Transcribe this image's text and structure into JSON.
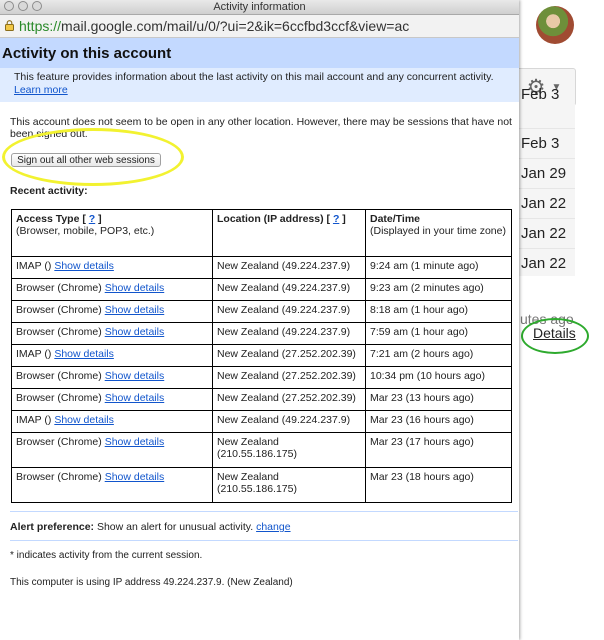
{
  "window": {
    "title": "Activity information",
    "url_scheme": "https://",
    "url_rest": "mail.google.com/mail/u/0/?ui=2&ik=6ccfbd3ccf&view=ac"
  },
  "header": {
    "title": "Activity on this account",
    "info_text": "This feature provides information about the last activity on this mail account and any concurrent activity.",
    "learn_more": "Learn more"
  },
  "notice": {
    "text": "This account does not seem to be open in any other location. However, there may be sessions that have not been signed out.",
    "signout_label": "Sign out all other web sessions"
  },
  "recent": {
    "heading": "Recent activity:",
    "table": {
      "col1_title": "Access Type",
      "col1_help": "?",
      "col1_sub": "(Browser, mobile, POP3, etc.)",
      "col2_title": "Location (IP address)",
      "col2_help": "?",
      "col3_title": "Date/Time",
      "col3_sub": "(Displayed in your time zone)",
      "show_details_label": "Show details",
      "rows": [
        {
          "type": "IMAP ()",
          "location": "New Zealand (49.224.237.9)",
          "time": "9:24 am (1 minute ago)"
        },
        {
          "type": "Browser (Chrome)",
          "location": "New Zealand (49.224.237.9)",
          "time": "9:23 am (2 minutes ago)"
        },
        {
          "type": "Browser (Chrome)",
          "location": "New Zealand (49.224.237.9)",
          "time": "8:18 am (1 hour ago)"
        },
        {
          "type": "Browser (Chrome)",
          "location": "New Zealand (49.224.237.9)",
          "time": "7:59 am (1 hour ago)"
        },
        {
          "type": "IMAP ()",
          "location": "New Zealand (27.252.202.39)",
          "time": "7:21 am (2 hours ago)"
        },
        {
          "type": "Browser (Chrome)",
          "location": "New Zealand (27.252.202.39)",
          "time": "10:34 pm (10 hours ago)"
        },
        {
          "type": "Browser (Chrome)",
          "location": "New Zealand (27.252.202.39)",
          "time": "Mar 23 (13 hours ago)"
        },
        {
          "type": "IMAP ()",
          "location": "New Zealand (49.224.237.9)",
          "time": "Mar 23 (16 hours ago)"
        },
        {
          "type": "Browser (Chrome)",
          "location": "New Zealand (210.55.186.175)",
          "time": "Mar 23 (17 hours ago)"
        },
        {
          "type": "Browser (Chrome)",
          "location": "New Zealand (210.55.186.175)",
          "time": "Mar 23 (18 hours ago)"
        }
      ]
    }
  },
  "alert": {
    "label": "Alert preference:",
    "text": "Show an alert for unusual activity.",
    "change": "change"
  },
  "footer": {
    "star_note": "* indicates activity from the current session.",
    "ip_note": "This computer is using IP address 49.224.237.9. (New Zealand)"
  },
  "background": {
    "dates": [
      "Feb 3",
      "Jan 29",
      "Jan 22",
      "Jan 22",
      "Jan 22"
    ],
    "date_top_partial": "Feb 3",
    "minutes_ago": "utes ago",
    "details": "Details",
    "gear_icon": "gear-icon"
  },
  "colors": {
    "header_blue": "#c3d9ff",
    "info_blue": "#e0ecff",
    "link_blue": "#1155cc",
    "highlight_yellow": "#f2f230",
    "highlight_green": "#2eaa2e"
  }
}
